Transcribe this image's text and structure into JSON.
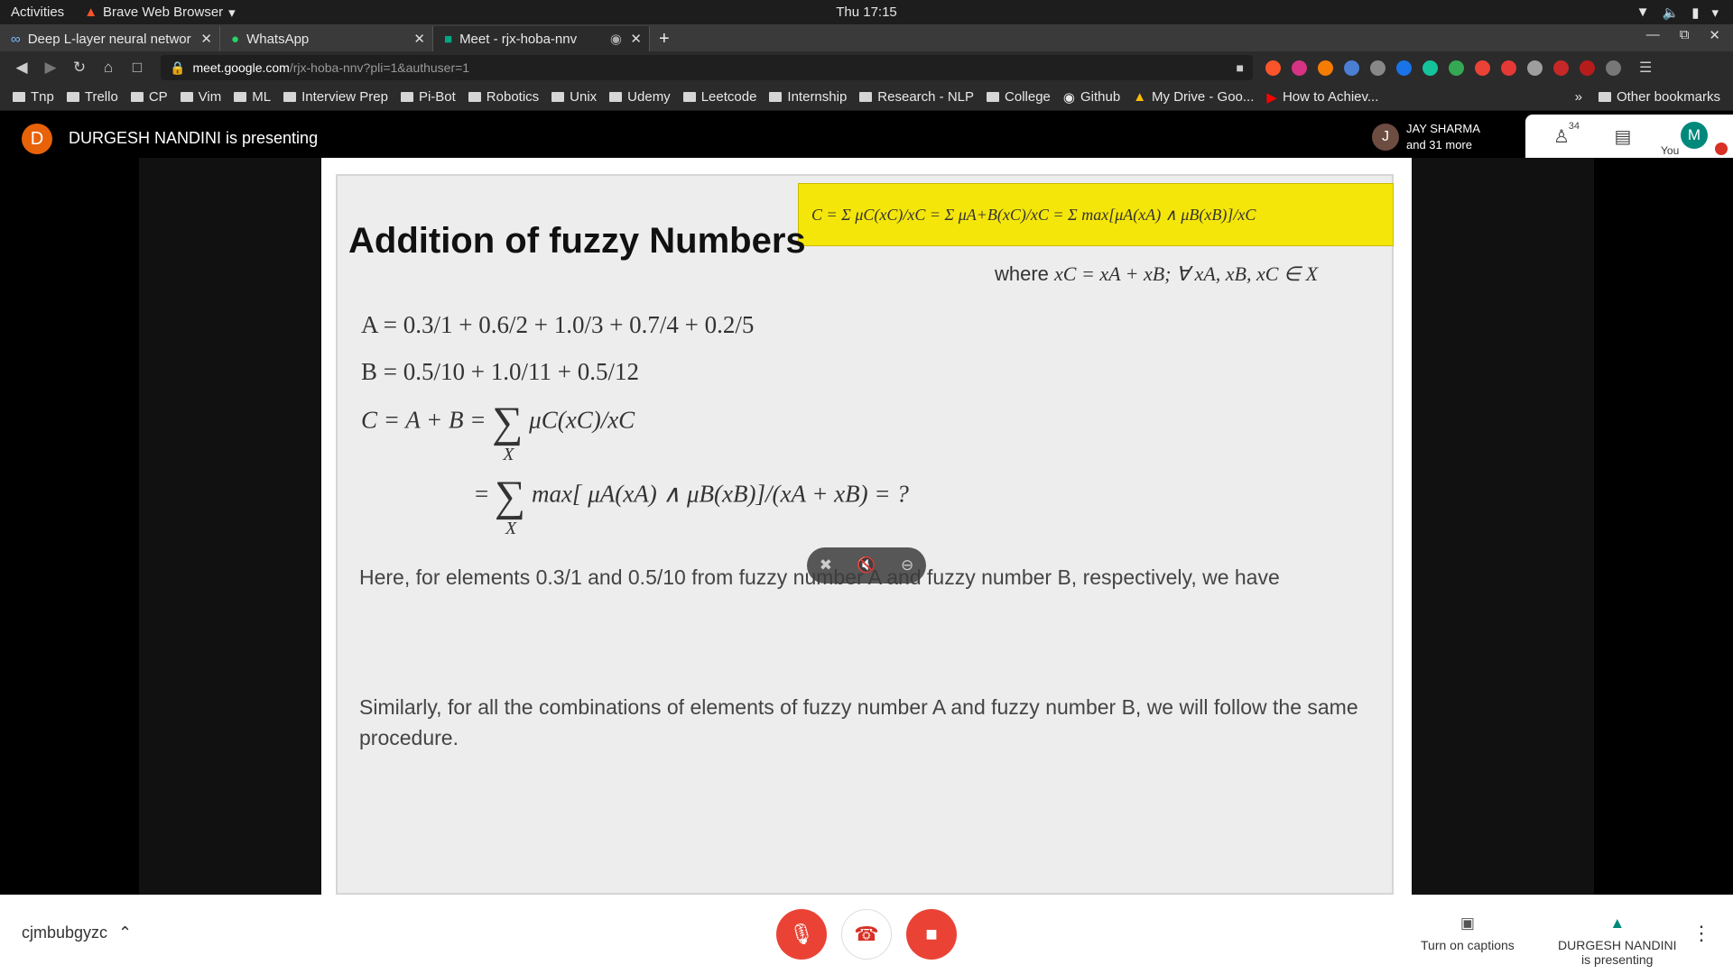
{
  "system": {
    "activities": "Activities",
    "browser_name": "Brave Web Browser",
    "clock": "Thu 17:15"
  },
  "tabs": [
    {
      "title": "Deep L-layer neural networ"
    },
    {
      "title": "WhatsApp"
    },
    {
      "title": "Meet - rjx-hoba-nnv"
    }
  ],
  "url": {
    "host": "meet.google.com",
    "path": "/rjx-hoba-nnv?pli=1&authuser=1"
  },
  "bookmarks": [
    "Tnp",
    "Trello",
    "CP",
    "Vim",
    "ML",
    "Interview Prep",
    "Pi-Bot",
    "Robotics",
    "Unix",
    "Udemy",
    "Leetcode",
    "Internship",
    "Research - NLP",
    "College",
    "Github",
    "My Drive - Goo...",
    "How to Achiev..."
  ],
  "bookmarks_other": "Other bookmarks",
  "bookmarks_overflow": "»",
  "meet": {
    "presenter_initial": "D",
    "presenting_banner": "DURGESH NANDINI is presenting",
    "participant_initial": "J",
    "participant_name": "JAY SHARMA",
    "participant_more": "and 31 more",
    "participant_count": "34",
    "you_label": "You",
    "me_initial": "M",
    "meeting_code": "cjmbubgyzc",
    "captions_label": "Turn on captions",
    "presenting_line1": "DURGESH NANDINI",
    "presenting_line2": "is presenting"
  },
  "slide": {
    "title": "Addition of fuzzy Numbers",
    "formula": "C = Σ μC(xC)/xC = Σ μA+B(xC)/xC = Σ max[μA(xA) ∧ μB(xB)]/xC",
    "where_prefix": "where",
    "where_math": "xC = xA + xB; ∀ xA, xB, xC ∈ X",
    "eq_a": "A = 0.3/1 + 0.6/2 + 1.0/3 + 0.7/4 + 0.2/5",
    "eq_b": "B = 0.5/10 + 1.0/11 + 0.5/12",
    "eq_c_lhs": "C = A + B =",
    "eq_c_rhs": "μC(xC)/xC",
    "eq_d": "max[ μA(xA) ∧ μB(xB)]/(xA + xB) = ?",
    "paragraph1": "Here, for elements 0.3/1 and 0.5/10 from fuzzy number A and fuzzy number B, respectively, we have",
    "paragraph2": "Similarly, for all the combinations of elements of fuzzy number A and fuzzy number B, we will follow the same procedure."
  },
  "colors": {
    "accent_red": "#ea4335",
    "highlight_yellow": "#f5e60a",
    "presenter_orange": "#e8620a"
  }
}
